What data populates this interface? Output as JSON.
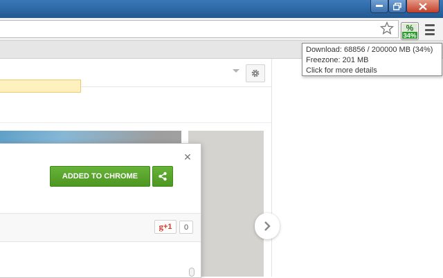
{
  "window": {
    "controls": [
      "minimize",
      "maximize",
      "close"
    ]
  },
  "toolbar": {
    "bookmark_icon": "star-icon",
    "extension_badge": {
      "top": "%",
      "bottom": "34%",
      "color": "#2d9e2d"
    },
    "menu_icon": "menu-icon"
  },
  "tooltip": {
    "line1": "Download: 68856 / 200000 MB (34%)",
    "line2": "Freezone: 201 MB",
    "line3": "Click for more details"
  },
  "dialog": {
    "added_label": "ADDED TO CHROME",
    "share_icon": "share-icon",
    "close_icon": "close-icon",
    "gplus_label": "+1",
    "gplus_count": "0",
    "accent": "#4d9722"
  },
  "page": {
    "next_icon": "chevron-right-icon",
    "settings_icon": "gear-icon"
  }
}
